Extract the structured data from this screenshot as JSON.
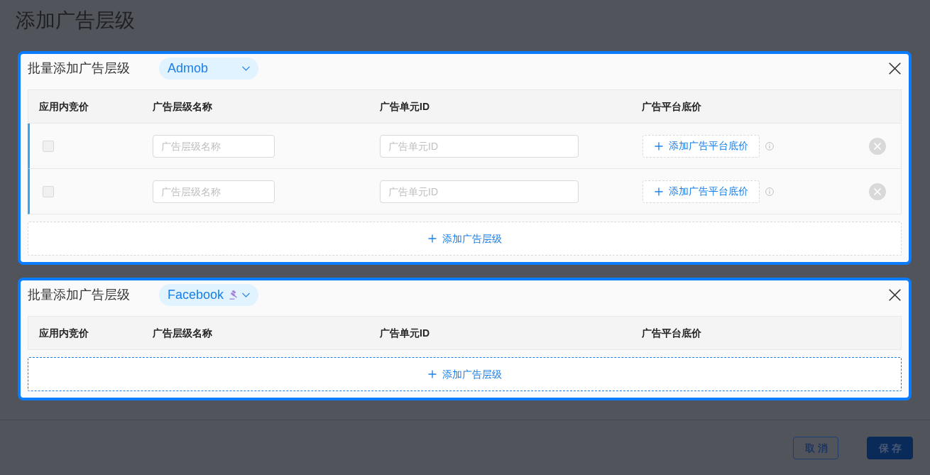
{
  "page": {
    "title": "添加广告层级"
  },
  "panels": [
    {
      "title": "批量添加广告层级",
      "network": {
        "label": "Admob",
        "bidding": false
      },
      "columns": [
        "应用内竞价",
        "广告层级名称",
        "广告单元ID",
        "广告平台底价"
      ],
      "rows": [
        {
          "in_app_bidding": {
            "checked": false,
            "disabled": true
          },
          "name_field": {
            "placeholder": "广告层级名称"
          },
          "unit_id_field": {
            "placeholder": "广告单元ID"
          },
          "floor_button": "添加广告平台底价"
        },
        {
          "in_app_bidding": {
            "checked": false,
            "disabled": true
          },
          "name_field": {
            "placeholder": "广告层级名称"
          },
          "unit_id_field": {
            "placeholder": "广告单元ID"
          },
          "floor_button": "添加广告平台底价"
        }
      ],
      "add_button": {
        "label": "添加广告层级",
        "focused": false
      }
    },
    {
      "title": "批量添加广告层级",
      "network": {
        "label": "Facebook",
        "bidding": true
      },
      "columns": [
        "应用内竞价",
        "广告层级名称",
        "广告单元ID",
        "广告平台底价"
      ],
      "add_button": {
        "label": "添加广告层级",
        "focused": true
      }
    }
  ],
  "footer": {
    "buttons": [
      {
        "label": "取 消",
        "kind": "outline"
      },
      {
        "label": "保 存",
        "kind": "primary"
      }
    ]
  }
}
